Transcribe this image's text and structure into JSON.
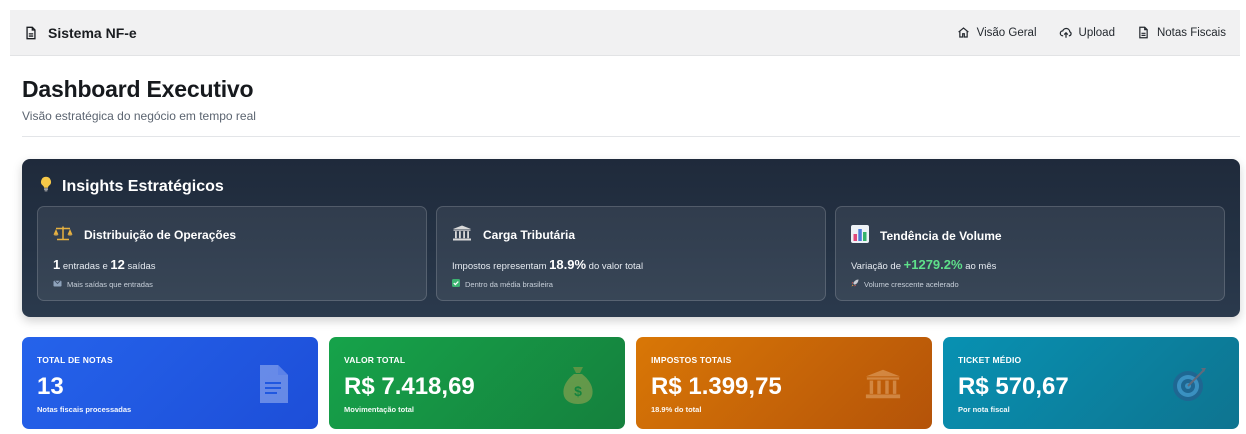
{
  "app": {
    "name": "Sistema NF-e"
  },
  "nav": [
    {
      "label": "Visão Geral",
      "icon": "home-icon"
    },
    {
      "label": "Upload",
      "icon": "cloud-upload-icon"
    },
    {
      "label": "Notas Fiscais",
      "icon": "document-icon"
    }
  ],
  "header": {
    "title": "Dashboard Executivo",
    "subtitle": "Visão estratégica do negócio em tempo real"
  },
  "insights": {
    "title": "Insights Estratégicos",
    "cards": [
      {
        "title": "Distribuição de Operações",
        "icon": "balance-scale-icon",
        "entradas": "1",
        "entradas_text": "entradas e",
        "saidas": "12",
        "saidas_text": "saídas",
        "note": "Mais saídas que entradas"
      },
      {
        "title": "Carga Tributária",
        "icon": "bank-icon",
        "prefix": "Impostos representam",
        "value": "18.9%",
        "suffix": "do valor total",
        "note": "Dentro da média brasileira"
      },
      {
        "title": "Tendência de Volume",
        "icon": "bar-chart-icon",
        "prefix": "Variação de",
        "value": "+1279.2%",
        "suffix": "ao mês",
        "note": "Volume crescente acelerado"
      }
    ]
  },
  "kpis": [
    {
      "label": "TOTAL DE NOTAS",
      "value": "13",
      "sub": "Notas fiscais processadas",
      "icon": "document-icon",
      "color": "#2563eb"
    },
    {
      "label": "VALOR TOTAL",
      "value": "R$ 7.418,69",
      "sub": "Movimentação total",
      "icon": "money-bag-icon",
      "color": "#16a34a"
    },
    {
      "label": "IMPOSTOS TOTAIS",
      "value": "R$ 1.399,75",
      "sub": "18.9% do total",
      "icon": "bank-icon",
      "color": "#d97706"
    },
    {
      "label": "TICKET MÉDIO",
      "value": "R$ 570,67",
      "sub": "Por nota fiscal",
      "icon": "target-icon",
      "color": "#0891b2"
    }
  ]
}
